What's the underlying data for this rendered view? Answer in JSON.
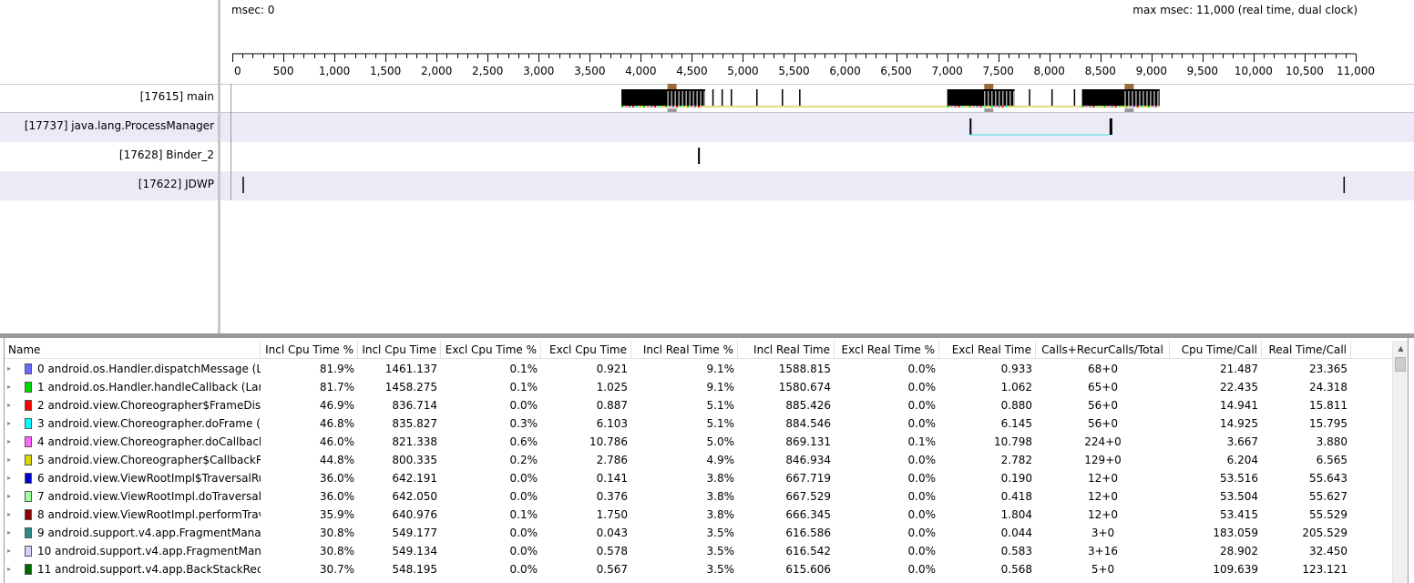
{
  "timeline": {
    "msec_label": "msec: 0",
    "max_msec_label": "max msec: 11,000 (real time, dual clock)",
    "axis_ticks": [
      "0",
      "500",
      "1,000",
      "1,500",
      "2,000",
      "2,500",
      "3,000",
      "3,500",
      "4,000",
      "4,500",
      "5,000",
      "5,500",
      "6,000",
      "6,500",
      "7,000",
      "7,500",
      "8,000",
      "8,500",
      "9,000",
      "9,500",
      "10,000",
      "10,500",
      "11,000"
    ],
    "axis_max": 11000,
    "threads": [
      {
        "label": "[17615] main",
        "shaded": false,
        "bordered": true
      },
      {
        "label": "[17737] java.lang.ProcessManager",
        "shaded": true,
        "bordered": false
      },
      {
        "label": "[17628] Binder_2",
        "shaded": false,
        "bordered": false
      },
      {
        "label": "[17622] JDWP",
        "shaded": true,
        "bordered": false
      }
    ],
    "main_blocks_msec": [
      [
        3810,
        4630
      ],
      [
        7000,
        7660
      ],
      [
        8320,
        9080
      ]
    ],
    "main_gap_ticks_msec": [
      4700,
      4790,
      4880,
      5130,
      5380,
      5550,
      7800,
      8020,
      8240
    ],
    "process_manager_range_msec": [
      7220,
      8590
    ],
    "binder_event_msec": 4560,
    "jdwp_events_msec": [
      100,
      10880
    ]
  },
  "table": {
    "columns": [
      {
        "label": "Name"
      },
      {
        "label": "Incl Cpu Time %"
      },
      {
        "label": "Incl Cpu Time"
      },
      {
        "label": "Excl Cpu Time %"
      },
      {
        "label": "Excl Cpu Time"
      },
      {
        "label": "Incl Real Time %"
      },
      {
        "label": "Incl Real Time"
      },
      {
        "label": "Excl Real Time %"
      },
      {
        "label": "Excl Real Time"
      },
      {
        "label": "Calls+RecurCalls/Total"
      },
      {
        "label": "Cpu Time/Call"
      },
      {
        "label": "Real Time/Call"
      }
    ],
    "rows": [
      {
        "color": "#6a6aff",
        "name": "0 android.os.Handler.dispatchMessage (L",
        "v": [
          "81.9%",
          "1461.137",
          "0.1%",
          "0.921",
          "9.1%",
          "1588.815",
          "0.0%",
          "0.933",
          "68+0",
          "21.487",
          "23.365"
        ]
      },
      {
        "color": "#00d800",
        "name": "1 android.os.Handler.handleCallback (Lan",
        "v": [
          "81.7%",
          "1458.275",
          "0.1%",
          "1.025",
          "9.1%",
          "1580.674",
          "0.0%",
          "1.062",
          "65+0",
          "22.435",
          "24.318"
        ]
      },
      {
        "color": "#ff0000",
        "name": "2 android.view.Choreographer$FrameDisp",
        "v": [
          "46.9%",
          "836.714",
          "0.0%",
          "0.887",
          "5.1%",
          "885.426",
          "0.0%",
          "0.880",
          "56+0",
          "14.941",
          "15.811"
        ]
      },
      {
        "color": "#00ffff",
        "name": "3 android.view.Choreographer.doFrame (",
        "v": [
          "46.8%",
          "835.827",
          "0.3%",
          "6.103",
          "5.1%",
          "884.546",
          "0.0%",
          "6.145",
          "56+0",
          "14.925",
          "15.795"
        ]
      },
      {
        "color": "#ff66ff",
        "name": "4 android.view.Choreographer.doCallback",
        "v": [
          "46.0%",
          "821.338",
          "0.6%",
          "10.786",
          "5.0%",
          "869.131",
          "0.1%",
          "10.798",
          "224+0",
          "3.667",
          "3.880"
        ]
      },
      {
        "color": "#d8d800",
        "name": "5 android.view.Choreographer$CallbackR",
        "v": [
          "44.8%",
          "800.335",
          "0.2%",
          "2.786",
          "4.9%",
          "846.934",
          "0.0%",
          "2.782",
          "129+0",
          "6.204",
          "6.565"
        ]
      },
      {
        "color": "#0000c8",
        "name": "6 android.view.ViewRootImpl$TraversalRu",
        "v": [
          "36.0%",
          "642.191",
          "0.0%",
          "0.141",
          "3.8%",
          "667.719",
          "0.0%",
          "0.190",
          "12+0",
          "53.516",
          "55.643"
        ]
      },
      {
        "color": "#a0ffa0",
        "name": "7 android.view.ViewRootImpl.doTraversal",
        "v": [
          "36.0%",
          "642.050",
          "0.0%",
          "0.376",
          "3.8%",
          "667.529",
          "0.0%",
          "0.418",
          "12+0",
          "53.504",
          "55.627"
        ]
      },
      {
        "color": "#8b0000",
        "name": "8 android.view.ViewRootImpl.performTrav",
        "v": [
          "35.9%",
          "640.976",
          "0.1%",
          "1.750",
          "3.8%",
          "666.345",
          "0.0%",
          "1.804",
          "12+0",
          "53.415",
          "55.529"
        ]
      },
      {
        "color": "#2e8b8b",
        "name": "9 android.support.v4.app.FragmentManag",
        "v": [
          "30.8%",
          "549.177",
          "0.0%",
          "0.043",
          "3.5%",
          "616.586",
          "0.0%",
          "0.044",
          "3+0",
          "183.059",
          "205.529"
        ]
      },
      {
        "color": "#d0d0ff",
        "name": "10 android.support.v4.app.FragmentMana",
        "v": [
          "30.8%",
          "549.134",
          "0.0%",
          "0.578",
          "3.5%",
          "616.542",
          "0.0%",
          "0.583",
          "3+16",
          "28.902",
          "32.450"
        ]
      },
      {
        "color": "#006400",
        "name": "11 android.support.v4.app.BackStackReco",
        "v": [
          "30.7%",
          "548.195",
          "0.0%",
          "0.567",
          "3.5%",
          "615.606",
          "0.0%",
          "0.568",
          "5+0",
          "109.639",
          "123.121"
        ]
      }
    ]
  }
}
